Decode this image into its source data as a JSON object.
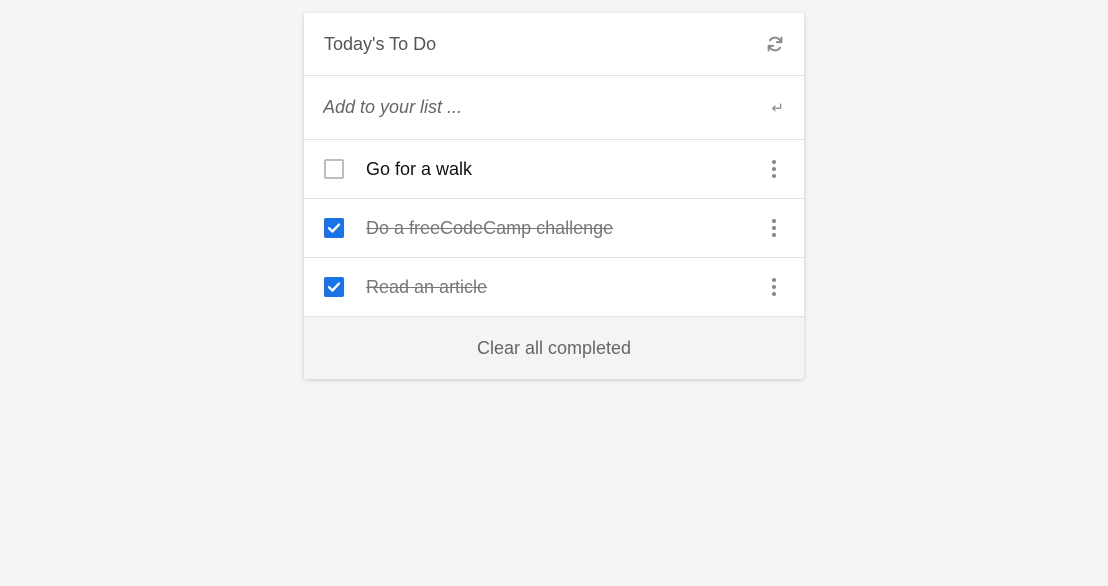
{
  "header": {
    "title": "Today's To Do",
    "refresh_icon": "refresh-icon"
  },
  "add": {
    "placeholder": "Add to your list ...",
    "enter_icon": "↵"
  },
  "todos": [
    {
      "label": "Go for a walk",
      "completed": false
    },
    {
      "label": "Do a freeCodeCamp challenge",
      "completed": true
    },
    {
      "label": "Read an article",
      "completed": true
    }
  ],
  "footer": {
    "clear_label": "Clear all completed"
  },
  "colors": {
    "accent": "#1a73e8",
    "background": "#f5f5f5"
  }
}
